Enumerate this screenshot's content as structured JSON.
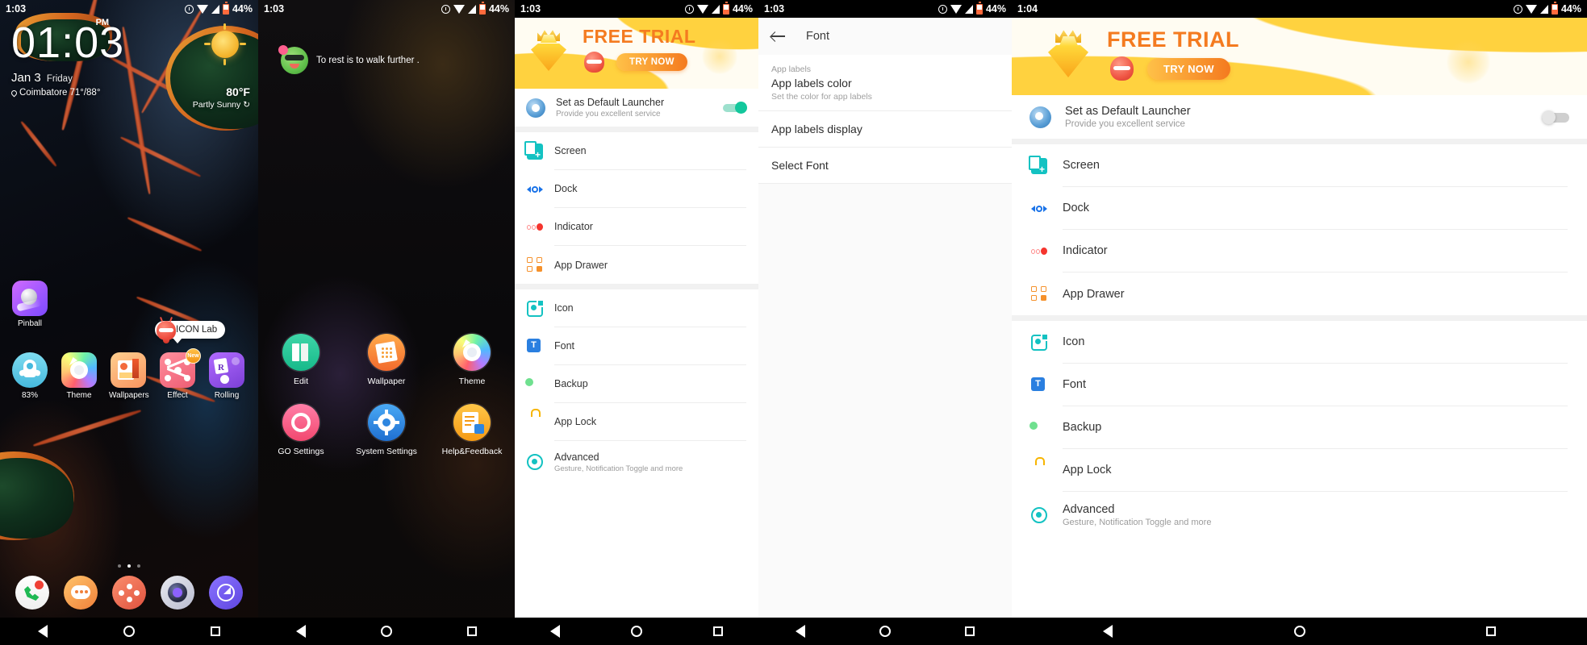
{
  "panels": [
    {
      "id": "home-screen",
      "statusbar": {
        "time": "1:03",
        "battery": "44%",
        "icons": [
          "alarm-icon",
          "wifi-icon",
          "signal-icon",
          "battery-icon"
        ]
      },
      "clock": {
        "time": "01:03",
        "ampm": "PM",
        "date": "Jan 3",
        "weekday": "Friday",
        "location": "Coimbatore",
        "range": "71°/88°"
      },
      "weather": {
        "temp": "80°F",
        "condition": "Partly Sunny",
        "refresh": "↻",
        "icon": "sun-icon"
      },
      "top_app": {
        "label": "Pinball",
        "icon": "pinball-icon"
      },
      "tooltip": {
        "text": "ICON Lab",
        "mascot": "mascot-icon"
      },
      "apps": [
        {
          "label": "83%",
          "icon": "booster-icon",
          "badge": ""
        },
        {
          "label": "Theme",
          "icon": "theme-icon",
          "badge": ""
        },
        {
          "label": "Wallpapers",
          "icon": "wallpapers-icon",
          "badge": ""
        },
        {
          "label": "Effect",
          "icon": "effect-icon",
          "badge": "New"
        },
        {
          "label": "Rolling",
          "icon": "rolling-icon",
          "badge": ""
        }
      ],
      "pages": {
        "count": 3,
        "active": 1
      },
      "dock": [
        {
          "icon": "phone-icon"
        },
        {
          "icon": "messages-icon"
        },
        {
          "icon": "app-drawer-icon"
        },
        {
          "icon": "camera-icon"
        },
        {
          "icon": "browser-icon"
        }
      ],
      "navbar": [
        "back-icon",
        "home-icon",
        "recents-icon"
      ]
    },
    {
      "id": "launcher-menu",
      "statusbar": {
        "time": "1:03",
        "battery": "44%"
      },
      "quote": {
        "text": "To rest is to walk further .",
        "icon": "quote-face-icon"
      },
      "menu": [
        {
          "label": "Edit",
          "icon": "edit-icon"
        },
        {
          "label": "Wallpaper",
          "icon": "wallpaper-icon"
        },
        {
          "label": "Theme",
          "icon": "theme-icon"
        },
        {
          "label": "GO Settings",
          "icon": "go-settings-icon"
        },
        {
          "label": "System Settings",
          "icon": "system-settings-icon"
        },
        {
          "label": "Help&Feedback",
          "icon": "help-feedback-icon"
        }
      ],
      "navbar": [
        "back-icon",
        "home-icon",
        "recents-icon"
      ]
    },
    {
      "id": "go-settings-list",
      "statusbar": {
        "time": "1:03",
        "battery": "44%"
      },
      "banner": {
        "title": "FREE TRIAL",
        "button": "TRY NOW",
        "icons": [
          "diamond-icon",
          "crown-icon",
          "mascot-icon"
        ]
      },
      "default_launcher": {
        "title": "Set as Default Launcher",
        "subtitle": "Provide you excellent service",
        "toggle": "on"
      },
      "items": [
        {
          "title": "Screen",
          "subtitle": "",
          "icon": "screen-icon"
        },
        {
          "title": "Dock",
          "subtitle": "",
          "icon": "dock-icon"
        },
        {
          "title": "Indicator",
          "subtitle": "",
          "icon": "indicator-icon"
        },
        {
          "title": "App Drawer",
          "subtitle": "",
          "icon": "app-drawer-icon"
        },
        {
          "title": "Icon",
          "subtitle": "",
          "icon": "icon-icon"
        },
        {
          "title": "Font",
          "subtitle": "",
          "icon": "font-icon"
        },
        {
          "title": "Backup",
          "subtitle": "",
          "icon": "backup-icon"
        },
        {
          "title": "App Lock",
          "subtitle": "",
          "icon": "app-lock-icon"
        },
        {
          "title": "Advanced",
          "subtitle": "Gesture, Notification Toggle and more",
          "icon": "advanced-icon"
        }
      ],
      "navbar": [
        "back-icon",
        "home-icon",
        "recents-icon"
      ]
    },
    {
      "id": "font-settings",
      "statusbar": {
        "time": "1:03",
        "battery": "44%"
      },
      "appbar": {
        "title": "Font",
        "back": "back-arrow-icon"
      },
      "section_label": "App labels",
      "rows": [
        {
          "title": "App labels color",
          "subtitle": "Set the color for app labels"
        },
        {
          "title": "App labels display",
          "subtitle": ""
        },
        {
          "title": "Select Font",
          "subtitle": ""
        }
      ],
      "navbar": [
        "back-icon",
        "home-icon",
        "recents-icon"
      ]
    },
    {
      "id": "go-settings-list-2",
      "statusbar": {
        "time": "1:04",
        "battery": "44%"
      },
      "banner": {
        "title": "FREE TRIAL",
        "button": "TRY NOW"
      },
      "default_launcher": {
        "title": "Set as Default Launcher",
        "subtitle": "Provide you excellent service",
        "toggle": "off"
      },
      "items": [
        {
          "title": "Screen",
          "subtitle": ""
        },
        {
          "title": "Dock",
          "subtitle": ""
        },
        {
          "title": "Indicator",
          "subtitle": ""
        },
        {
          "title": "App Drawer",
          "subtitle": ""
        },
        {
          "title": "Icon",
          "subtitle": ""
        },
        {
          "title": "Font",
          "subtitle": ""
        },
        {
          "title": "Backup",
          "subtitle": ""
        },
        {
          "title": "App Lock",
          "subtitle": ""
        },
        {
          "title": "Advanced",
          "subtitle": "Gesture, Notification Toggle and more"
        }
      ],
      "navbar": [
        "back-icon",
        "home-icon",
        "recents-icon"
      ]
    }
  ],
  "colors": {
    "accent_orange": "#f47b20",
    "banner_yellow": "#ffd23f",
    "toggle_on": "#13c79c",
    "teal": "#13c2c2",
    "nav_bg": "#000000"
  }
}
